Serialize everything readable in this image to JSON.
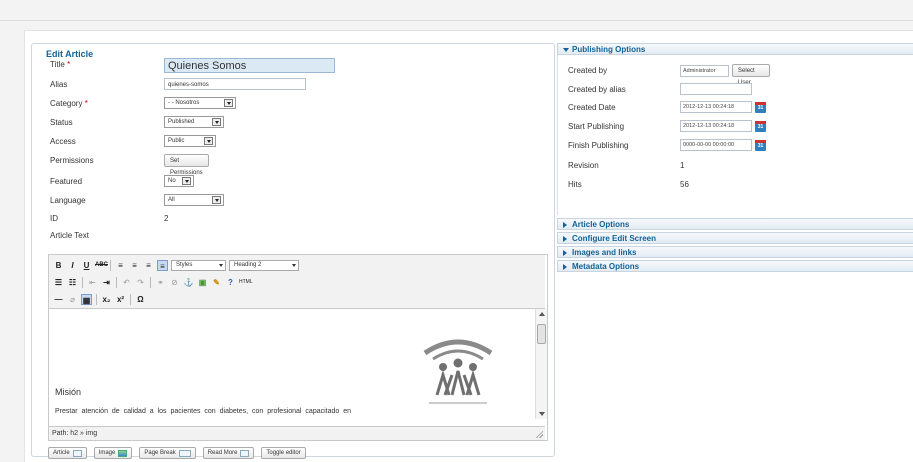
{
  "form": {
    "legend": "Edit Article",
    "title_label": "Title",
    "title_value": "Quienes Somos",
    "alias_label": "Alias",
    "alias_value": "quienes-somos",
    "category_label": "Category",
    "category_value": "- - Nosotros",
    "status_label": "Status",
    "status_value": "Published",
    "access_label": "Access",
    "access_value": "Public",
    "permissions_label": "Permissions",
    "permissions_button": "Set Permissions",
    "featured_label": "Featured",
    "featured_value": "No",
    "language_label": "Language",
    "language_value": "All",
    "id_label": "ID",
    "id_value": "2",
    "article_text_label": "Article Text",
    "required_marker": "*"
  },
  "editor": {
    "styles_select": "Styles",
    "format_select": "Heading 2",
    "content_heading": "Misión",
    "content_paragraph": "Prestar atención de calidad a los pacientes con diabetes, con profesional capacitado en",
    "path_text": "Path: h2 » img",
    "bottom_buttons": [
      "Article",
      "Image",
      "Page Break",
      "Read More",
      "Toggle editor"
    ]
  },
  "publishing": {
    "header": "Publishing Options",
    "created_by_label": "Created by",
    "created_by_value": "Administrator",
    "select_user_button": "Select User",
    "created_by_alias_label": "Created by alias",
    "created_by_alias_value": "",
    "created_date_label": "Created Date",
    "created_date_value": "2012-12-13 00:24:18",
    "start_publishing_label": "Start Publishing",
    "start_publishing_value": "2012-12-13 00:24:18",
    "finish_publishing_label": "Finish Publishing",
    "finish_publishing_value": "0000-00-00 00:00:00",
    "revision_label": "Revision",
    "revision_value": "1",
    "hits_label": "Hits",
    "hits_value": "56",
    "calendar_icon_text": "31"
  },
  "panels": {
    "article_options": "Article Options",
    "configure_edit_screen": "Configure Edit Screen",
    "images_and_links": "Images and links",
    "metadata_options": "Metadata Options"
  }
}
